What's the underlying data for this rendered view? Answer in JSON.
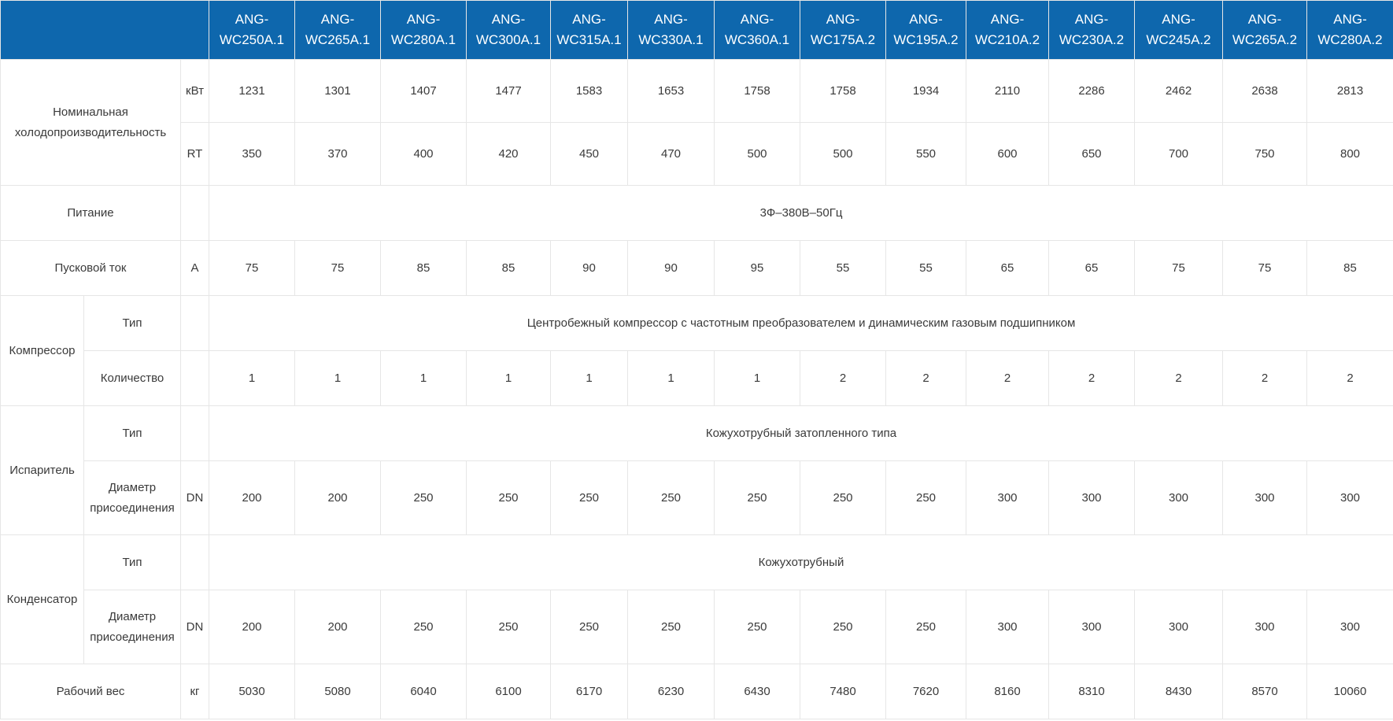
{
  "colors": {
    "header_bg": "#0e67ad",
    "header_text": "#ffffff",
    "border": "#e6e6e6",
    "text": "#3a3a3a"
  },
  "models": [
    "ANG-WC250A.1",
    "ANG-WC265A.1",
    "ANG-WC280A.1",
    "ANG-WC300A.1",
    "ANG-WC315A.1",
    "ANG-WC330A.1",
    "ANG-WC360A.1",
    "ANG-WC175A.2",
    "ANG-WC195A.2",
    "ANG-WC210A.2",
    "ANG-WC230A.2",
    "ANG-WC245A.2",
    "ANG-WC265A.2",
    "ANG-WC280A.2"
  ],
  "rows": {
    "capacity": {
      "label": "Номинальная холодопроизводительность",
      "kw": {
        "unit": "кВт",
        "values": [
          "1231",
          "1301",
          "1407",
          "1477",
          "1583",
          "1653",
          "1758",
          "1758",
          "1934",
          "2110",
          "2286",
          "2462",
          "2638",
          "2813"
        ]
      },
      "rt": {
        "unit": "RT",
        "values": [
          "350",
          "370",
          "400",
          "420",
          "450",
          "470",
          "500",
          "500",
          "550",
          "600",
          "650",
          "700",
          "750",
          "800"
        ]
      }
    },
    "power": {
      "label": "Питание",
      "value": "3Ф–380В–50Гц"
    },
    "start_current": {
      "label": "Пусковой ток",
      "unit": "А",
      "values": [
        "75",
        "75",
        "85",
        "85",
        "90",
        "90",
        "95",
        "55",
        "55",
        "65",
        "65",
        "75",
        "75",
        "85"
      ]
    },
    "compressor": {
      "label": "Компрессор",
      "type_label": "Тип",
      "type_value": "Центробежный компрессор с частотным преобразователем и динамическим газовым подшипником",
      "count_label": "Количество",
      "count_values": [
        "1",
        "1",
        "1",
        "1",
        "1",
        "1",
        "1",
        "2",
        "2",
        "2",
        "2",
        "2",
        "2",
        "2"
      ]
    },
    "evaporator": {
      "label": "Испаритель",
      "type_label": "Тип",
      "type_value": "Кожухотрубный затопленного типа",
      "dn_label": "Диаметр присоединения",
      "dn_unit": "DN",
      "dn_values": [
        "200",
        "200",
        "250",
        "250",
        "250",
        "250",
        "250",
        "250",
        "250",
        "300",
        "300",
        "300",
        "300",
        "300"
      ]
    },
    "condenser": {
      "label": "Конденсатор",
      "type_label": "Тип",
      "type_value": "Кожухотрубный",
      "dn_label": "Диаметр присоединения",
      "dn_unit": "DN",
      "dn_values": [
        "200",
        "200",
        "250",
        "250",
        "250",
        "250",
        "250",
        "250",
        "250",
        "300",
        "300",
        "300",
        "300",
        "300"
      ]
    },
    "weight": {
      "label": "Рабочий вес",
      "unit": "кг",
      "values": [
        "5030",
        "5080",
        "6040",
        "6100",
        "6170",
        "6230",
        "6430",
        "7480",
        "7620",
        "8160",
        "8310",
        "8430",
        "8570",
        "10060"
      ]
    }
  }
}
